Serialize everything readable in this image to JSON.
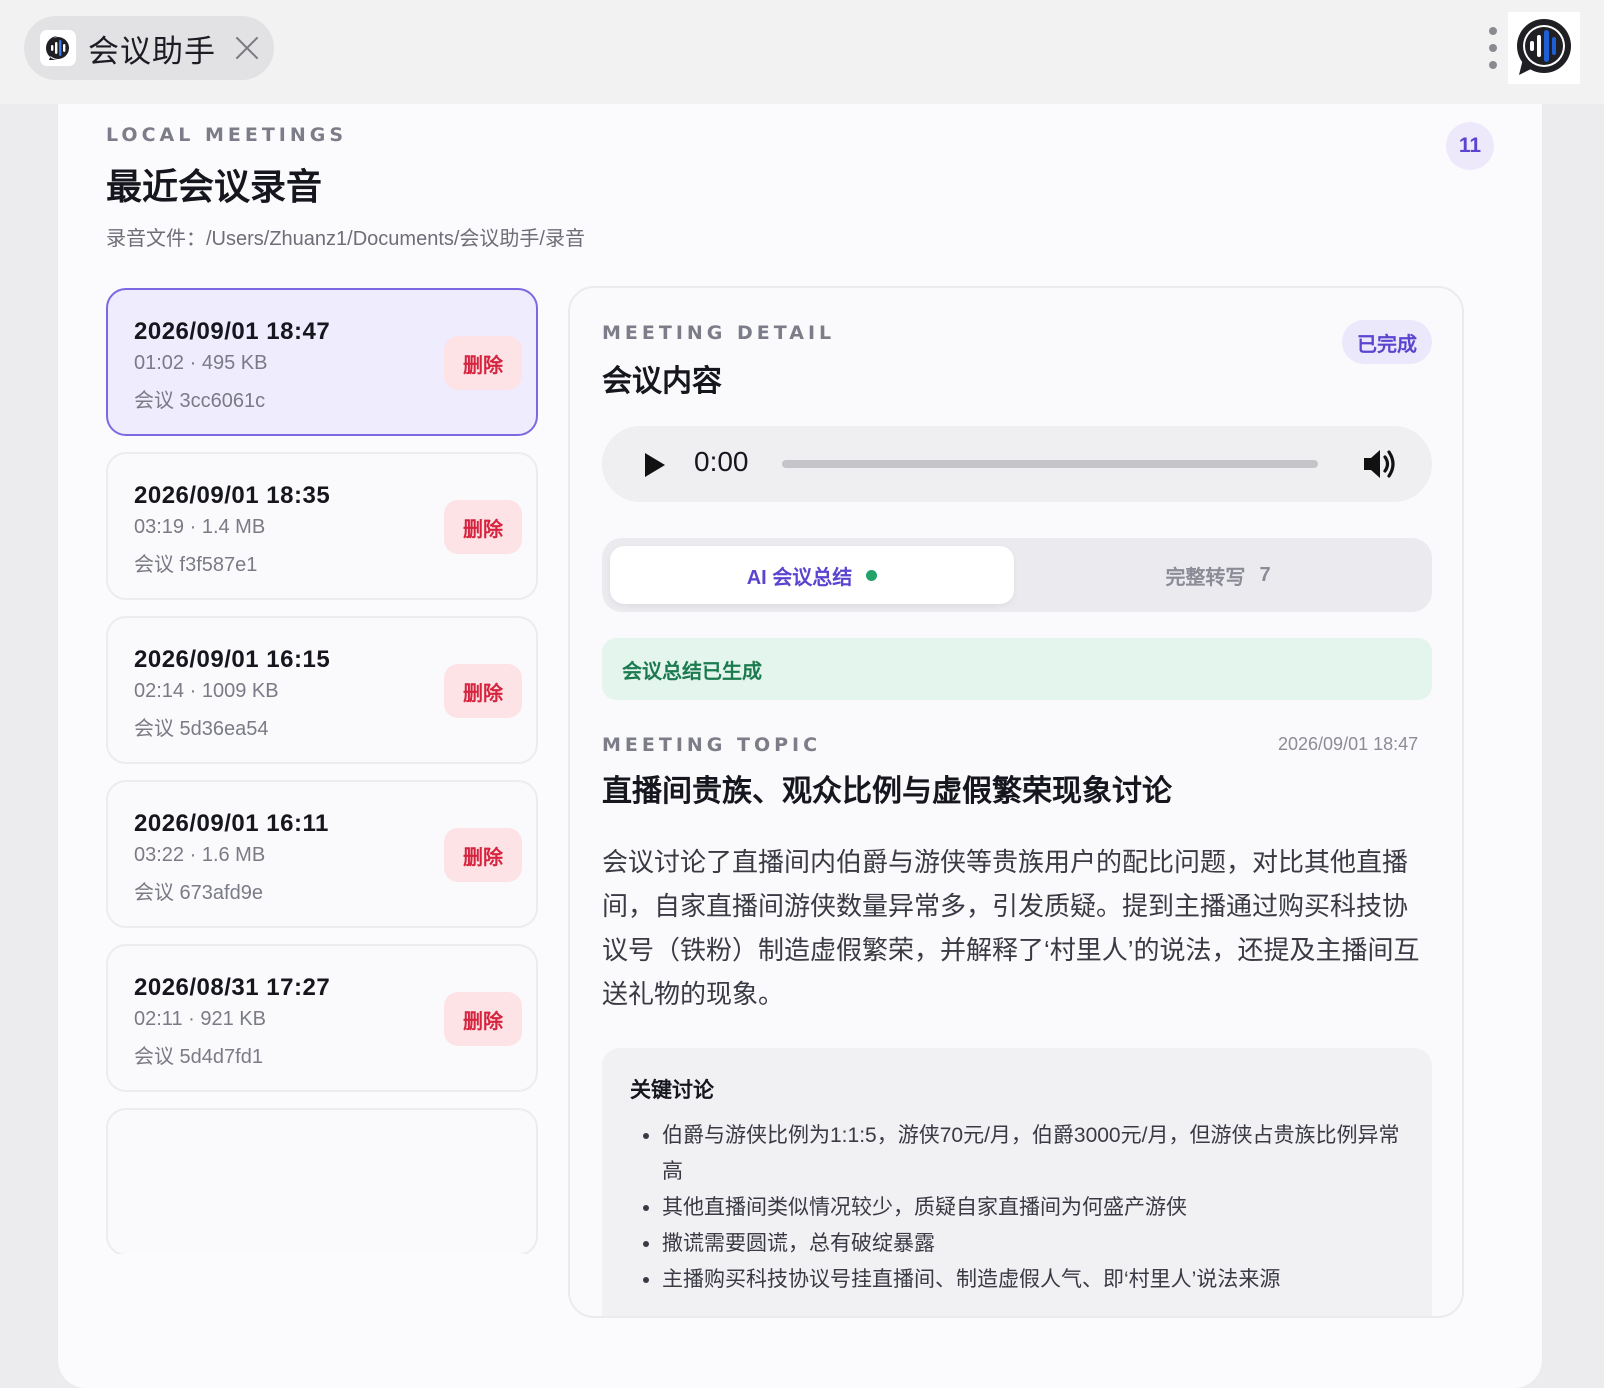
{
  "app": {
    "tab_title": "会议助手",
    "logo_icon": "audio-wave-logo",
    "accent_color": "#5b44cf",
    "logo_blue": "#1f5fd6"
  },
  "header": {
    "eyebrow": "LOCAL MEETINGS",
    "title": "最近会议录音",
    "path": "录音文件：/Users/Zhuanz1/Documents/会议助手/录音",
    "count": "11"
  },
  "meetings": [
    {
      "date": "2026/09/01 18:47",
      "meta": "01:02 · 495 KB",
      "name": "会议 3cc6061c",
      "delete_label": "删除",
      "selected": true
    },
    {
      "date": "2026/09/01 18:35",
      "meta": "03:19 · 1.4 MB",
      "name": "会议 f3f587e1",
      "delete_label": "删除"
    },
    {
      "date": "2026/09/01 16:15",
      "meta": "02:14 · 1009 KB",
      "name": "会议 5d36ea54",
      "delete_label": "删除"
    },
    {
      "date": "2026/09/01 16:11",
      "meta": "03:22 · 1.6 MB",
      "name": "会议 673afd9e",
      "delete_label": "删除"
    },
    {
      "date": "2026/08/31 17:27",
      "meta": "02:11 · 921 KB",
      "name": "会议 5d4d7fd1",
      "delete_label": "删除"
    }
  ],
  "detail": {
    "eyebrow": "MEETING DETAIL",
    "title": "会议内容",
    "status": "已完成",
    "player": {
      "time": "0:00",
      "progress": 0
    },
    "tabs": [
      {
        "label": "AI 会议总结",
        "active": true
      },
      {
        "label": "完整转写",
        "count": "7"
      }
    ],
    "success_message": "会议总结已生成",
    "topic": {
      "eyebrow": "MEETING TOPIC",
      "date": "2026/09/01 18:47",
      "title": "直播间贵族、观众比例与虚假繁荣现象讨论",
      "summary": "会议讨论了直播间内伯爵与游侠等贵族用户的配比问题，对比其他直播间，自家直播间游侠数量异常多，引发质疑。提到主播通过购买科技协议号（铁粉）制造虚假繁荣，并解释了‘村里人’的说法，还提及主播间互送礼物的现象。"
    },
    "key_discussion": {
      "title": "关键讨论",
      "items": [
        "伯爵与游侠比例为1:1:5，游侠70元/月，伯爵3000元/月，但游侠占贵族比例异常高",
        "其他直播间类似情况较少，质疑自家直播间为何盛产游侠",
        "撒谎需要圆谎，总有破绽暴露",
        "主播购买科技协议号挂直播间、制造虚假人气、即‘村里人’说法来源"
      ]
    }
  }
}
